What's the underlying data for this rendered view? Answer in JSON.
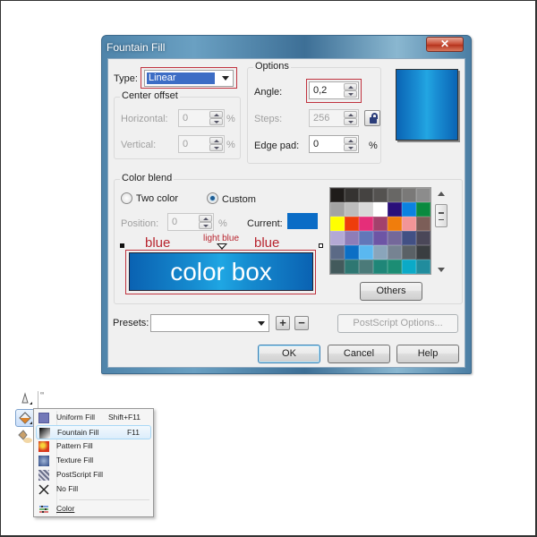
{
  "dialog": {
    "title": "Fountain Fill",
    "close_label": "✕",
    "type": {
      "label": "Type:",
      "value": "Linear"
    },
    "center_offset": {
      "title": "Center offset",
      "horizontal": {
        "label": "Horizontal:",
        "value": "0",
        "unit": "%"
      },
      "vertical": {
        "label": "Vertical:",
        "value": "0",
        "unit": "%"
      }
    },
    "options": {
      "title": "Options",
      "angle": {
        "label": "Angle:",
        "value": "0,2"
      },
      "steps": {
        "label": "Steps:",
        "value": "256"
      },
      "edge_pad": {
        "label": "Edge pad:",
        "value": "0",
        "unit": "%"
      }
    },
    "preview_colors": {
      "edge": "#0A64B4",
      "center": "#22A6E2"
    },
    "color_blend": {
      "title": "Color blend",
      "two_color_label": "Two color",
      "custom_label": "Custom",
      "selected_mode": "Custom",
      "position": {
        "label": "Position:",
        "value": "0",
        "unit": "%"
      },
      "current_label": "Current:",
      "current_color": "#0A6CC6",
      "annotations": {
        "left": "blue",
        "middle": "light blue",
        "right": "blue"
      },
      "color_box_label": "color box",
      "palette": [
        "#1f1c1a",
        "#353331",
        "#454341",
        "#545250",
        "#686765",
        "#7a7978",
        "#8c8c8c",
        "#a3a3a3",
        "#bdbdbd",
        "#d9d9d9",
        "#ffffff",
        "#2a0f7a",
        "#0b82e0",
        "#0a8a3f",
        "#ffff00",
        "#ee3d0b",
        "#e52e79",
        "#a3416c",
        "#f07d0c",
        "#f29597",
        "#7c5e58",
        "#b3a9d5",
        "#8e7db8",
        "#6277b9",
        "#6d55a5",
        "#74689a",
        "#425084",
        "#4a4758",
        "#5b6a86",
        "#0c6fc5",
        "#5ab8f0",
        "#8aa5bb",
        "#768392",
        "#5a6166",
        "#3a3e41",
        "#435a5c",
        "#2e7772",
        "#4b7a79",
        "#1f8678",
        "#1c8d74",
        "#0baac7",
        "#218c9d"
      ],
      "others_label": "Others"
    },
    "presets": {
      "label": "Presets:",
      "value": "",
      "add_label": "+",
      "remove_label": "−"
    },
    "postscript_options_label": "PostScript Options...",
    "buttons": {
      "ok": "OK",
      "cancel": "Cancel",
      "help": "Help"
    }
  },
  "fill_menu": {
    "ruler_label": "∞",
    "items": [
      {
        "label": "Uniform Fill",
        "shortcut": "Shift+F11",
        "icon": "uniform-fill-icon"
      },
      {
        "label": "Fountain Fill",
        "shortcut": "F11",
        "icon": "fountain-fill-icon",
        "highlighted": true
      },
      {
        "label": "Pattern Fill",
        "shortcut": "",
        "icon": "pattern-fill-icon"
      },
      {
        "label": "Texture Fill",
        "shortcut": "",
        "icon": "texture-fill-icon"
      },
      {
        "label": "PostScript Fill",
        "shortcut": "",
        "icon": "postscript-fill-icon"
      },
      {
        "label": "No Fill",
        "shortcut": "",
        "icon": "no-fill-icon"
      },
      {
        "label": "Color",
        "shortcut": "",
        "icon": "color-docker-icon"
      }
    ]
  }
}
